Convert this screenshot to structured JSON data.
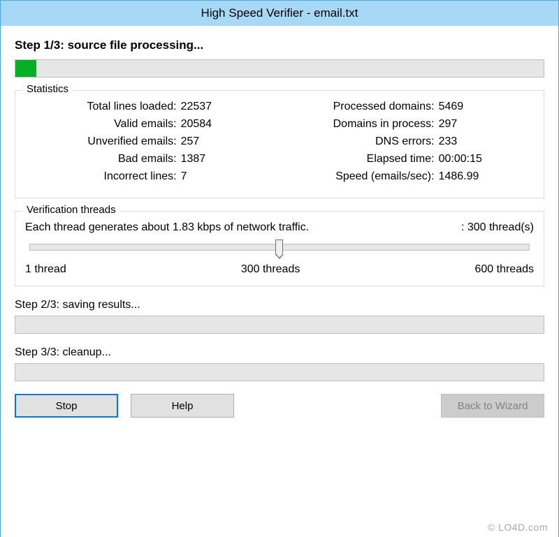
{
  "window": {
    "title": "High Speed Verifier - email.txt"
  },
  "step1": {
    "label": "Step 1/3: source file processing...",
    "progress_pct": 4
  },
  "statistics": {
    "legend": "Statistics",
    "left": [
      {
        "label": "Total lines loaded:",
        "value": "22537"
      },
      {
        "label": "Valid emails:",
        "value": "20584"
      },
      {
        "label": "Unverified emails:",
        "value": "257"
      },
      {
        "label": "Bad emails:",
        "value": "1387"
      },
      {
        "label": "Incorrect lines:",
        "value": "7"
      }
    ],
    "right": [
      {
        "label": "Processed domains:",
        "value": "5469"
      },
      {
        "label": "Domains in process:",
        "value": "297"
      },
      {
        "label": "DNS errors:",
        "value": "233"
      },
      {
        "label": "Elapsed time:",
        "value": "00:00:15"
      },
      {
        "label": "Speed (emails/sec):",
        "value": "1486.99"
      }
    ]
  },
  "threads": {
    "legend": "Verification threads",
    "traffic_text": "Each thread generates about 1.83 kbps of network traffic.",
    "count_text": ": 300 thread(s)",
    "slider": {
      "min_label": "1 thread",
      "mid_label": "300 threads",
      "max_label": "600 threads",
      "position_pct": 50
    }
  },
  "step2": {
    "label": "Step 2/3: saving results..."
  },
  "step3": {
    "label": "Step 3/3: cleanup..."
  },
  "buttons": {
    "stop": "Stop",
    "help": "Help",
    "back": "Back to Wizard"
  },
  "watermark": "© LO4D.com"
}
